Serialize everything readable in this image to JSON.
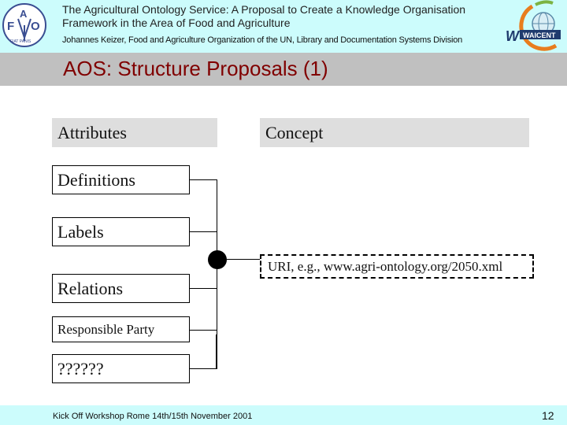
{
  "header": {
    "title": "The Agricultural Ontology Service: A Proposal to Create a Knowledge Organisation Framework in the Area of Food and Agriculture",
    "subtitle": "Johannes Keizer, Food and Agriculture Organization of the UN, Library and Documentation Systems Division",
    "left_logo": "fao-logo",
    "right_logo": "waicent-logo",
    "right_logo_text": "WAICENT"
  },
  "slide": {
    "title": "AOS: Structure Proposals (1)"
  },
  "diagram": {
    "attributes_heading": "Attributes",
    "concept_heading": "Concept",
    "attribute_boxes": [
      "Definitions",
      "Labels",
      "Relations",
      "Responsible Party",
      "??????"
    ],
    "uri_label": "URI, e.g., www.agri-ontology.org/2050.xml"
  },
  "footer": {
    "text": "Kick Off Workshop  Rome   14th/15th November 2001",
    "page_number": "12"
  }
}
